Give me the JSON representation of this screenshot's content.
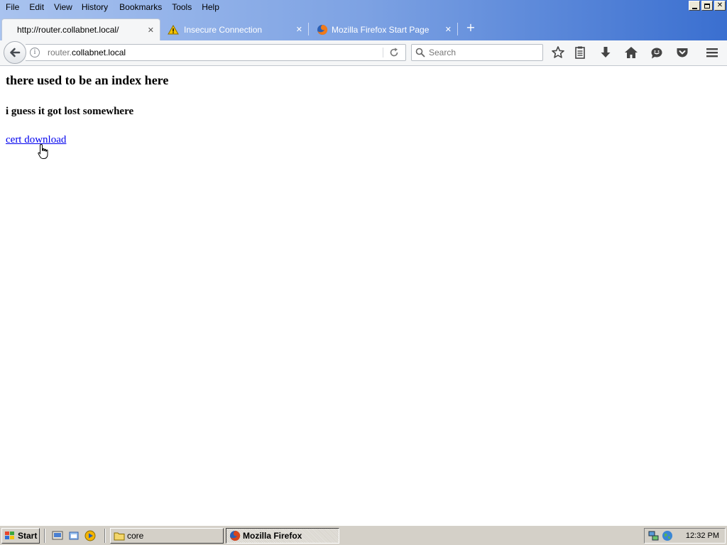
{
  "menu": {
    "items": [
      "File",
      "Edit",
      "View",
      "History",
      "Bookmarks",
      "Tools",
      "Help"
    ]
  },
  "window_controls": [
    "minimize",
    "restore",
    "close"
  ],
  "tabs": [
    {
      "label": "http://router.collabnet.local/",
      "icon": "none",
      "active": true
    },
    {
      "label": "Insecure Connection",
      "icon": "warning-icon",
      "active": false
    },
    {
      "label": "Mozilla Firefox Start Page",
      "icon": "firefox-icon",
      "active": false
    }
  ],
  "urlbar": {
    "domain_prefix": "router.",
    "domain": "collabnet.local"
  },
  "search": {
    "placeholder": "Search"
  },
  "toolbar_icons": [
    "bookmark-star-icon",
    "reading-list-icon",
    "downloads-icon",
    "home-icon",
    "hello-icon",
    "pocket-icon",
    "menu-icon"
  ],
  "page": {
    "heading": "there used to be an index here",
    "subheading": "i guess it got lost somewhere",
    "link": "cert download"
  },
  "taskbar": {
    "start_label": "Start",
    "tasks": [
      {
        "label": "core",
        "icon": "folder-icon",
        "pressed": false
      },
      {
        "label": "Mozilla Firefox",
        "icon": "firefox-icon",
        "pressed": true
      }
    ],
    "clock": "12:32 PM"
  },
  "colors": {
    "titlebar_gradient": [
      "#a9c3ef",
      "#3a6fd0"
    ],
    "link": "#0000ee",
    "taskbar": "#d4d0c8"
  }
}
